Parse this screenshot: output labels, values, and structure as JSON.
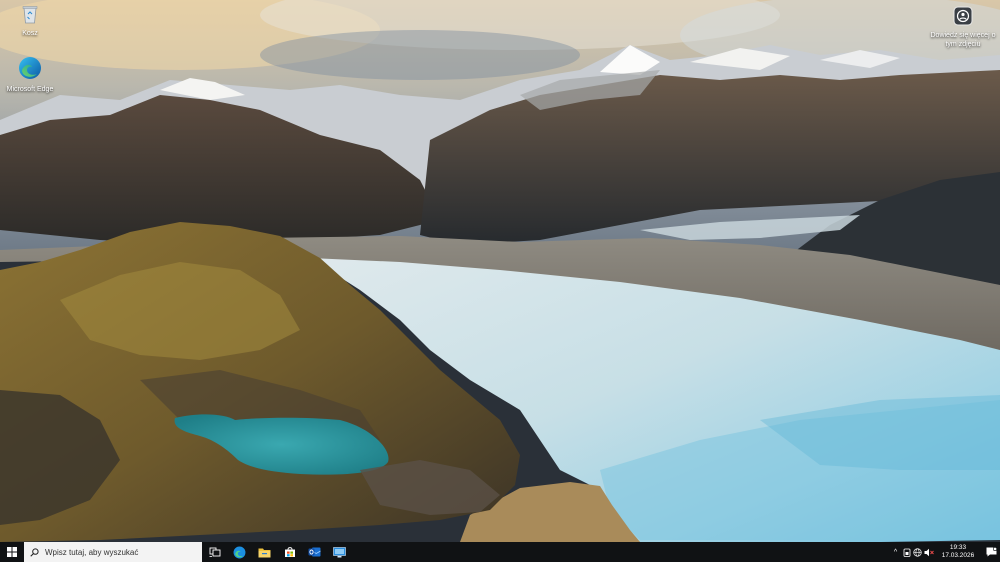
{
  "desktop": {
    "wallpaper": "glacier-valley-landscape",
    "icons": [
      {
        "name": "recycle-bin-icon",
        "label": "Kosz"
      },
      {
        "name": "microsoft-edge-icon",
        "label": "Microsoft Edge"
      },
      {
        "name": "learn-about-picture-icon",
        "label": "Dowiedz się więcej o tym zdjęciu"
      }
    ]
  },
  "taskbar": {
    "search_placeholder": "Wpisz tutaj, aby wyszukać",
    "apps": [
      "task-view-icon",
      "edge-icon",
      "file-explorer-icon",
      "microsoft-store-icon",
      "outlook-icon",
      "remote-desktop-icon"
    ],
    "tray": {
      "chevron": "^",
      "clock_time": "19:33",
      "clock_date": "17.03.2026"
    },
    "colors": {
      "taskbar_bg": "#101214",
      "search_bg": "#f3f3f3",
      "accent": "#0a84d8"
    }
  }
}
